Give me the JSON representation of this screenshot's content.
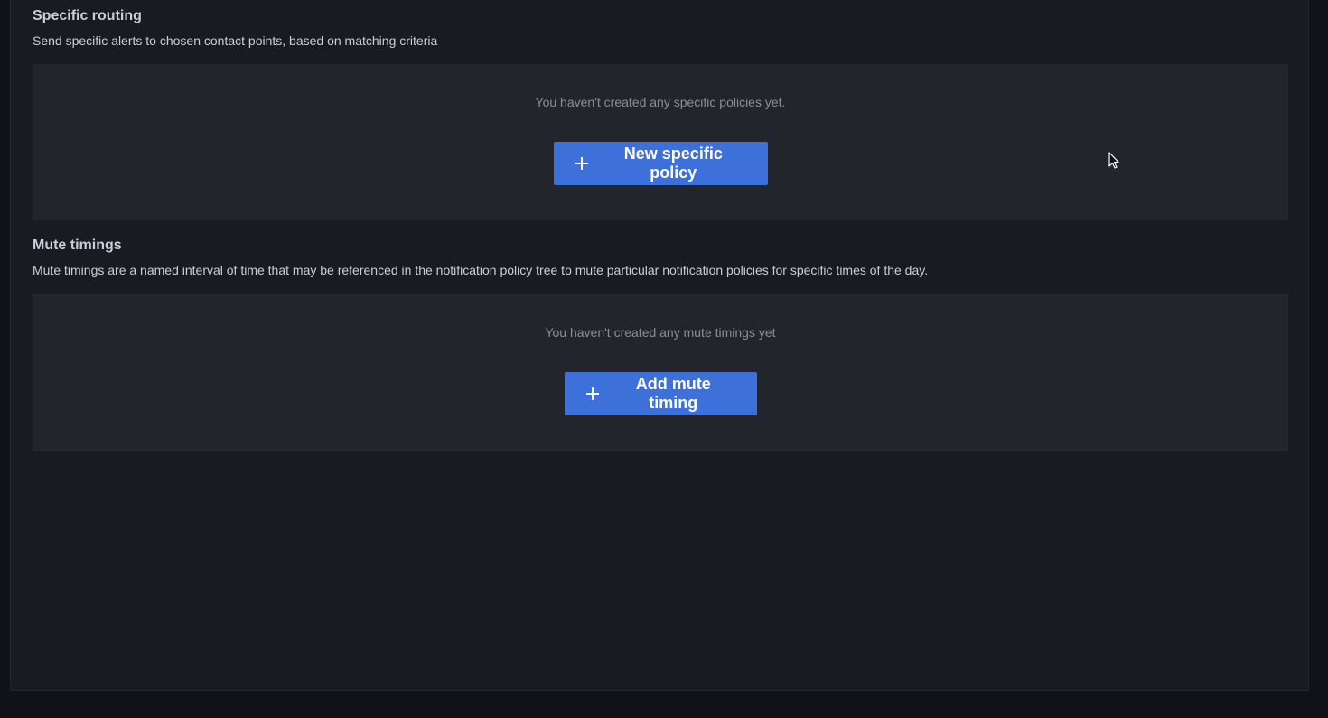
{
  "specific_routing": {
    "title": "Specific routing",
    "description": "Send specific alerts to chosen contact points, based on matching criteria",
    "empty_text": "You haven't created any specific policies yet.",
    "button_label": "New specific policy"
  },
  "mute_timings": {
    "title": "Mute timings",
    "description": "Mute timings are a named interval of time that may be referenced in the notification policy tree to mute particular notification policies for specific times of the day.",
    "empty_text": "You haven't created any mute timings yet",
    "button_label": "Add mute timing"
  },
  "icons": {
    "add": "plus-icon",
    "pointer": "mouse-cursor-icon"
  },
  "colors": {
    "background": "#111217",
    "panel": "#181b1f",
    "empty_box": "#22252b",
    "primary_button": "#3d71d9"
  }
}
